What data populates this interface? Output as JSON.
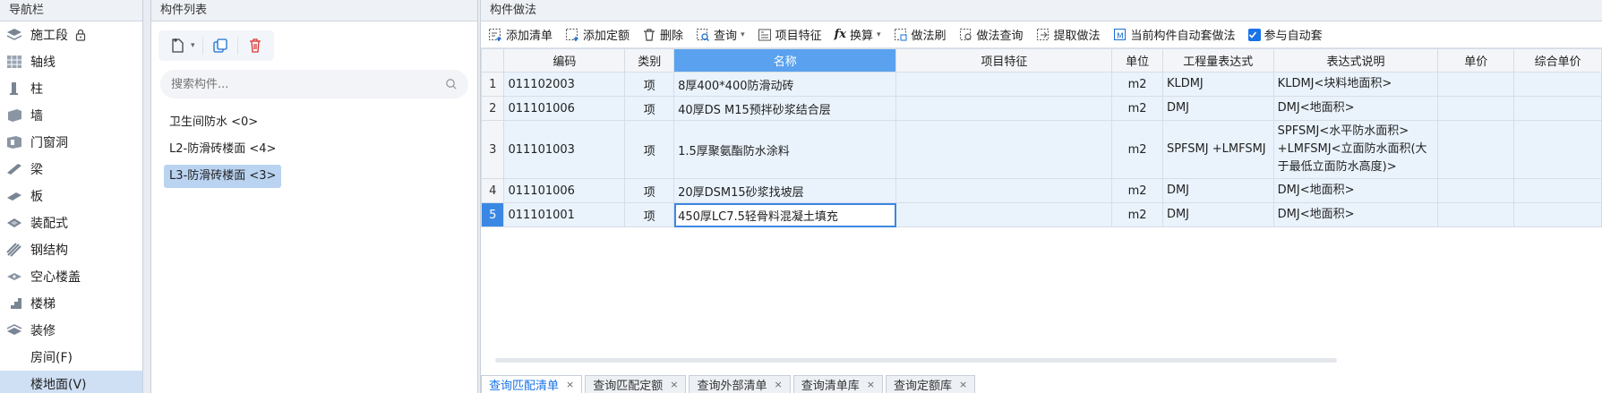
{
  "nav": {
    "title": "导航栏",
    "items": [
      {
        "label": "施工段",
        "icon": "layers-icon",
        "locked": true
      },
      {
        "label": "轴线",
        "icon": "grid-icon"
      },
      {
        "label": "柱",
        "icon": "column-icon"
      },
      {
        "label": "墙",
        "icon": "wall-icon"
      },
      {
        "label": "门窗洞",
        "icon": "door-window-icon"
      },
      {
        "label": "梁",
        "icon": "beam-icon"
      },
      {
        "label": "板",
        "icon": "slab-icon"
      },
      {
        "label": "装配式",
        "icon": "prefab-icon"
      },
      {
        "label": "钢结构",
        "icon": "steel-icon"
      },
      {
        "label": "空心楼盖",
        "icon": "hollow-floor-icon"
      },
      {
        "label": "楼梯",
        "icon": "stairs-icon"
      },
      {
        "label": "装修",
        "icon": "decoration-icon"
      }
    ],
    "sub_items": [
      {
        "label": "房间(F)"
      },
      {
        "label": "楼地面(V)",
        "selected": true
      }
    ]
  },
  "component_list": {
    "title": "构件列表",
    "search_placeholder": "搜索构件...",
    "items": [
      {
        "label": "卫生间防水 <0>"
      },
      {
        "label": "L2-防滑砖楼面 <4>"
      },
      {
        "label": "L3-防滑砖楼面 <3>",
        "selected": true
      }
    ]
  },
  "method": {
    "title": "构件做法",
    "toolbar": {
      "add_list": "添加清单",
      "add_quota": "添加定额",
      "delete": "删除",
      "query": "查询",
      "item_feature": "项目特征",
      "convert": "换算",
      "method_brush": "做法刷",
      "method_query": "做法查询",
      "extract_method": "提取做法",
      "auto_apply": "当前构件自动套做法",
      "join_auto": "参与自动套"
    },
    "columns": [
      "编码",
      "类别",
      "名称",
      "项目特征",
      "单位",
      "工程量表达式",
      "表达式说明",
      "单价",
      "综合单价"
    ],
    "rows": [
      {
        "num": "1",
        "code": "011102003",
        "type": "项",
        "name": "8厚400*400防滑动砖",
        "feature": "",
        "unit": "m2",
        "expr": "KLDMJ",
        "expr_desc": "KLDMJ<块料地面积>",
        "price": "",
        "comp_price": ""
      },
      {
        "num": "2",
        "code": "011101006",
        "type": "项",
        "name": "40厚DS M15预拌砂浆结合层",
        "feature": "",
        "unit": "m2",
        "expr": "DMJ",
        "expr_desc": "DMJ<地面积>",
        "price": "",
        "comp_price": ""
      },
      {
        "num": "3",
        "code": "011101003",
        "type": "项",
        "name": "1.5厚聚氨酯防水涂料",
        "feature": "",
        "unit": "m2",
        "expr": "SPFSMJ +LMFSMJ",
        "expr_desc": "SPFSMJ<水平防水面积> +LMFSMJ<立面防水面积(大于最低立面防水高度)>",
        "price": "",
        "comp_price": ""
      },
      {
        "num": "4",
        "code": "011101006",
        "type": "项",
        "name": "20厚DSM15砂浆找坡层",
        "feature": "",
        "unit": "m2",
        "expr": "DMJ",
        "expr_desc": "DMJ<地面积>",
        "price": "",
        "comp_price": ""
      },
      {
        "num": "5",
        "code": "011101001",
        "type": "项",
        "name": "450厚LC7.5轻骨料混凝土填充",
        "feature": "",
        "unit": "m2",
        "expr": "DMJ",
        "expr_desc": "DMJ<地面积>",
        "price": "",
        "comp_price": "",
        "selected": true
      }
    ],
    "bottom_tabs": [
      {
        "label": "查询匹配清单",
        "active": true
      },
      {
        "label": "查询匹配定额"
      },
      {
        "label": "查询外部清单"
      },
      {
        "label": "查询清单库"
      },
      {
        "label": "查询定额库"
      }
    ]
  }
}
